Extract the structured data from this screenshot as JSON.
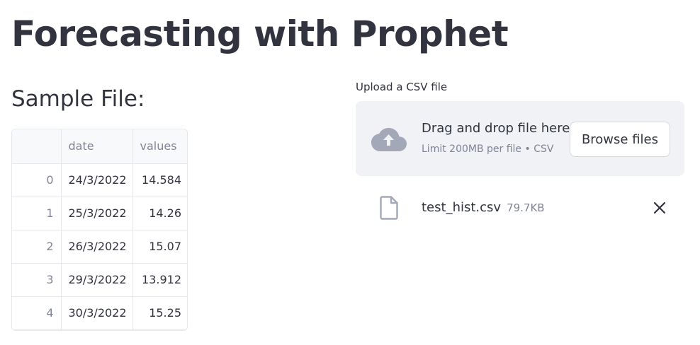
{
  "app": {
    "title": "Forecasting with Prophet"
  },
  "sample": {
    "heading": "Sample File:",
    "columns": [
      "",
      "date",
      "values"
    ],
    "rows": [
      {
        "index": "0",
        "date": "24/3/2022",
        "value": "14.584"
      },
      {
        "index": "1",
        "date": "25/3/2022",
        "value": "14.26"
      },
      {
        "index": "2",
        "date": "26/3/2022",
        "value": "15.07"
      },
      {
        "index": "3",
        "date": "29/3/2022",
        "value": "13.912"
      },
      {
        "index": "4",
        "date": "30/3/2022",
        "value": "15.25"
      }
    ]
  },
  "uploader": {
    "label": "Upload a CSV file",
    "drop_text": "Drag and drop file here",
    "limit_text": "Limit 200MB per file • CSV",
    "browse_label": "Browse files",
    "icon": "cloud-upload-icon",
    "file": {
      "name": "test_hist.csv",
      "size": "79.7KB",
      "icon": "file-icon",
      "remove_icon": "close-icon"
    }
  },
  "colors": {
    "text": "#31333f",
    "muted": "#808495",
    "dropzone_bg": "#f0f2f6",
    "border": "#e6e7ea",
    "icon": "#a3a8b8"
  }
}
